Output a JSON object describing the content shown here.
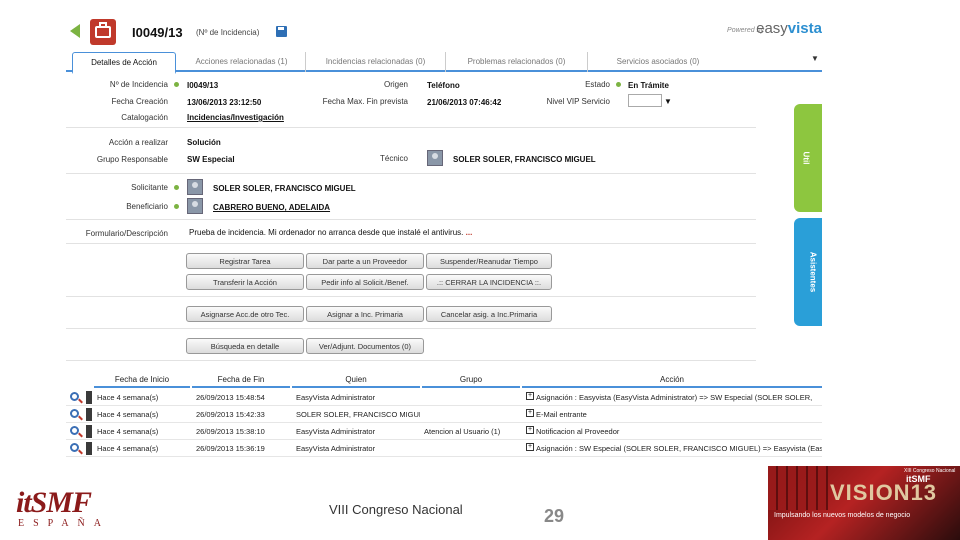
{
  "header": {
    "ticket_number": "I0049/13",
    "ticket_sub": "(Nº de Incidencia)",
    "powered_by": "Powered by",
    "brand_easy": "easy",
    "brand_vista": "vista"
  },
  "tabs": [
    {
      "label": "Detalles de Acción"
    },
    {
      "label": "Acciones relacionadas  (1)"
    },
    {
      "label": "Incidencias relacionadas  (0)"
    },
    {
      "label": "Problemas relacionados  (0)"
    },
    {
      "label": "Servicios asociados  (0)"
    }
  ],
  "form": {
    "incidencia_label": "Nº de Incidencia",
    "incidencia_value": "I0049/13",
    "origen_label": "Origen",
    "origen_value": "Teléfono",
    "estado_label": "Estado",
    "estado_value": "En Trámite",
    "fecha_creacion_label": "Fecha Creación",
    "fecha_creacion_value": "13/06/2013 23:12:50",
    "fecha_max_label": "Fecha Max. Fin prevista",
    "fecha_max_value": "21/06/2013 07:46:42",
    "nivel_vip_label": "Nivel VIP Servicio",
    "nivel_vip_arrow": "▼",
    "catalogacion_label": "Catalogación",
    "catalogacion_value": "Incidencias/Investigación",
    "accion_label": "Acción a realizar",
    "accion_value": "Solución",
    "grupo_label": "Grupo Responsable",
    "grupo_value": "SW Especial",
    "tecnico_label": "Técnico",
    "tecnico_value": "SOLER SOLER, FRANCISCO MIGUEL",
    "solicitante_label": "Solicitante",
    "solicitante_value": "SOLER SOLER, FRANCISCO MIGUEL",
    "beneficiario_label": "Beneficiario",
    "beneficiario_value": "CABRERO BUENO, ADELAIDA",
    "formulario_label": "Formulario/Descripción",
    "formulario_value": "Prueba de incidencia. Mi ordenador no arranca desde que instalé el antivirus.",
    "formulario_more": "..."
  },
  "buttons": {
    "registrar": "Registrar Tarea",
    "proveedor": "Dar parte a un Proveedor",
    "suspender": "Suspender/Reanudar Tiempo",
    "transferir": "Transferir la Acción",
    "pedir_info": "Pedir info al Solicit./Benef.",
    "cerrar": ".:: CERRAR LA INCIDENCIA ::.",
    "asignarse": "Asignarse Acc.de otro Tec.",
    "asignar_inc": "Asignar a Inc. Primaria",
    "cancelar_asig": "Cancelar asig. a Inc.Primaria",
    "busqueda": "Búsqueda en detalle",
    "ver_docs": "Ver/Adjunt. Documentos (0)"
  },
  "side_tabs": {
    "util": "Util",
    "asistentes": "Asistentes"
  },
  "grid": {
    "headers": [
      "Fecha de Inicio",
      "Fecha de Fin",
      "Quien",
      "Grupo",
      "Acción"
    ],
    "rows": [
      {
        "inicio": "Hace 4 semana(s)",
        "fin": "26/09/2013 15:48:54",
        "quien": "EasyVista Administrator",
        "grupo": "",
        "accion": "Asignación : Easyvista (EasyVista Administrator) => SW Especial (SOLER SOLER,"
      },
      {
        "inicio": "Hace 4 semana(s)",
        "fin": "26/09/2013 15:42:33",
        "quien": "SOLER SOLER, FRANCISCO MIGUEL",
        "grupo": "",
        "accion": "E-Mail entrante"
      },
      {
        "inicio": "Hace 4 semana(s)",
        "fin": "26/09/2013 15:38:10",
        "quien": "EasyVista Administrator",
        "grupo": "Atencion al Usuario (1)",
        "accion": "Notificacion al Proveedor"
      },
      {
        "inicio": "Hace 4 semana(s)",
        "fin": "26/09/2013 15:36:19",
        "quien": "EasyVista Administrator",
        "grupo": "",
        "accion": "Asignación : SW Especial (SOLER SOLER, FRANCISCO MIGUEL) => Easyvista (Easy"
      }
    ],
    "plus": "+"
  },
  "footer": {
    "logo_it": "itSMF",
    "logo_espana": "ESPAÑA",
    "congreso": "VIII Congreso Nacional",
    "page_number": "29",
    "vision_title": "VISION13",
    "vision_top": "XIII Congreso Nacional",
    "vision_itsmf": "itSMF",
    "vision_slogan": "Impulsando los nuevos modelos de negocio"
  },
  "colors": {
    "accent": "#4a90d9",
    "green": "#7cb342",
    "side_green": "#8dc63f",
    "side_blue": "#2a9fd8",
    "brand_red": "#8b1a1a"
  }
}
